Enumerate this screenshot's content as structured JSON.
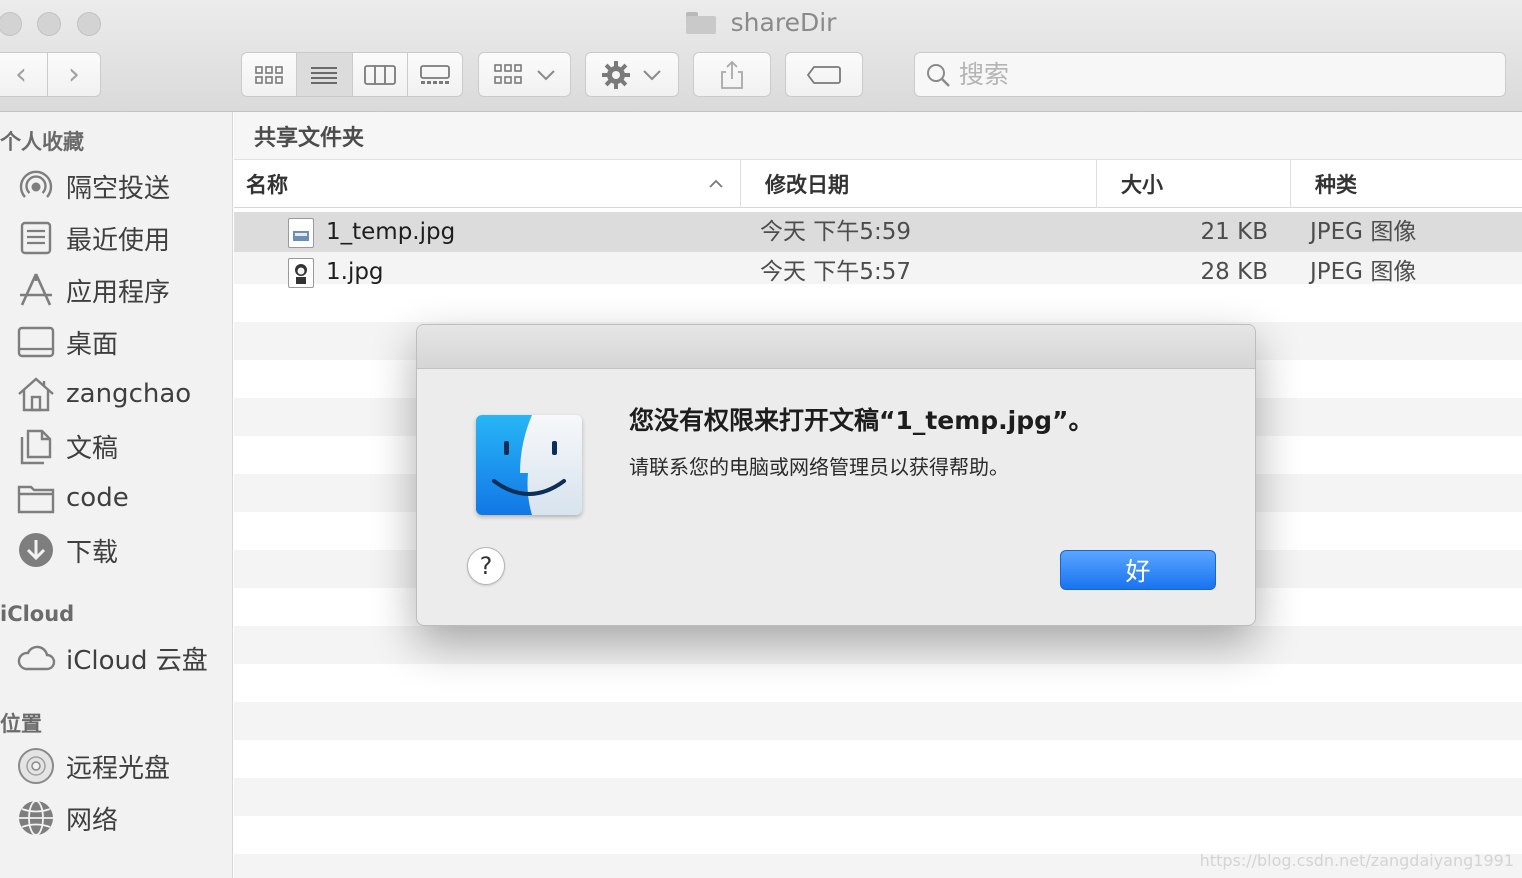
{
  "window": {
    "title": "shareDir"
  },
  "toolbar": {
    "search_placeholder": "搜索",
    "view_modes": [
      "icon-view",
      "list-view",
      "column-view",
      "gallery-view"
    ],
    "active_view": "list-view"
  },
  "sidebar": {
    "favorites_header": "个人收藏",
    "favorites": [
      {
        "label": "隔空投送",
        "icon": "airdrop-icon"
      },
      {
        "label": "最近使用",
        "icon": "recents-icon"
      },
      {
        "label": "应用程序",
        "icon": "applications-icon"
      },
      {
        "label": "桌面",
        "icon": "desktop-icon"
      },
      {
        "label": "zangchao",
        "icon": "home-icon"
      },
      {
        "label": "文稿",
        "icon": "documents-icon"
      },
      {
        "label": "code",
        "icon": "folder-icon"
      },
      {
        "label": "下载",
        "icon": "downloads-icon"
      }
    ],
    "icloud_header": "iCloud",
    "icloud": [
      {
        "label": "iCloud 云盘",
        "icon": "cloud-icon"
      }
    ],
    "locations_header": "位置",
    "locations": [
      {
        "label": "远程光盘",
        "icon": "disc-icon"
      },
      {
        "label": "网络",
        "icon": "network-icon"
      }
    ]
  },
  "main": {
    "path_title": "共享文件夹",
    "columns": {
      "name": "名称",
      "date": "修改日期",
      "size": "大小",
      "kind": "种类"
    },
    "files": [
      {
        "name": "1_temp.jpg",
        "date": "今天 下午5:59",
        "size": "21 KB",
        "kind": "JPEG 图像",
        "selected": true
      },
      {
        "name": "1.jpg",
        "date": "今天 下午5:57",
        "size": "28 KB",
        "kind": "JPEG 图像",
        "selected": false
      }
    ]
  },
  "dialog": {
    "message": "您没有权限来打开文稿“1_temp.jpg”。",
    "detail": "请联系您的电脑或网络管理员以获得帮助。",
    "help_label": "?",
    "ok_label": "好"
  },
  "colors": {
    "accent": "#1a73f0",
    "selected_row": "#dcdcdc"
  },
  "watermark": "https://blog.csdn.net/zangdaiyang1991"
}
